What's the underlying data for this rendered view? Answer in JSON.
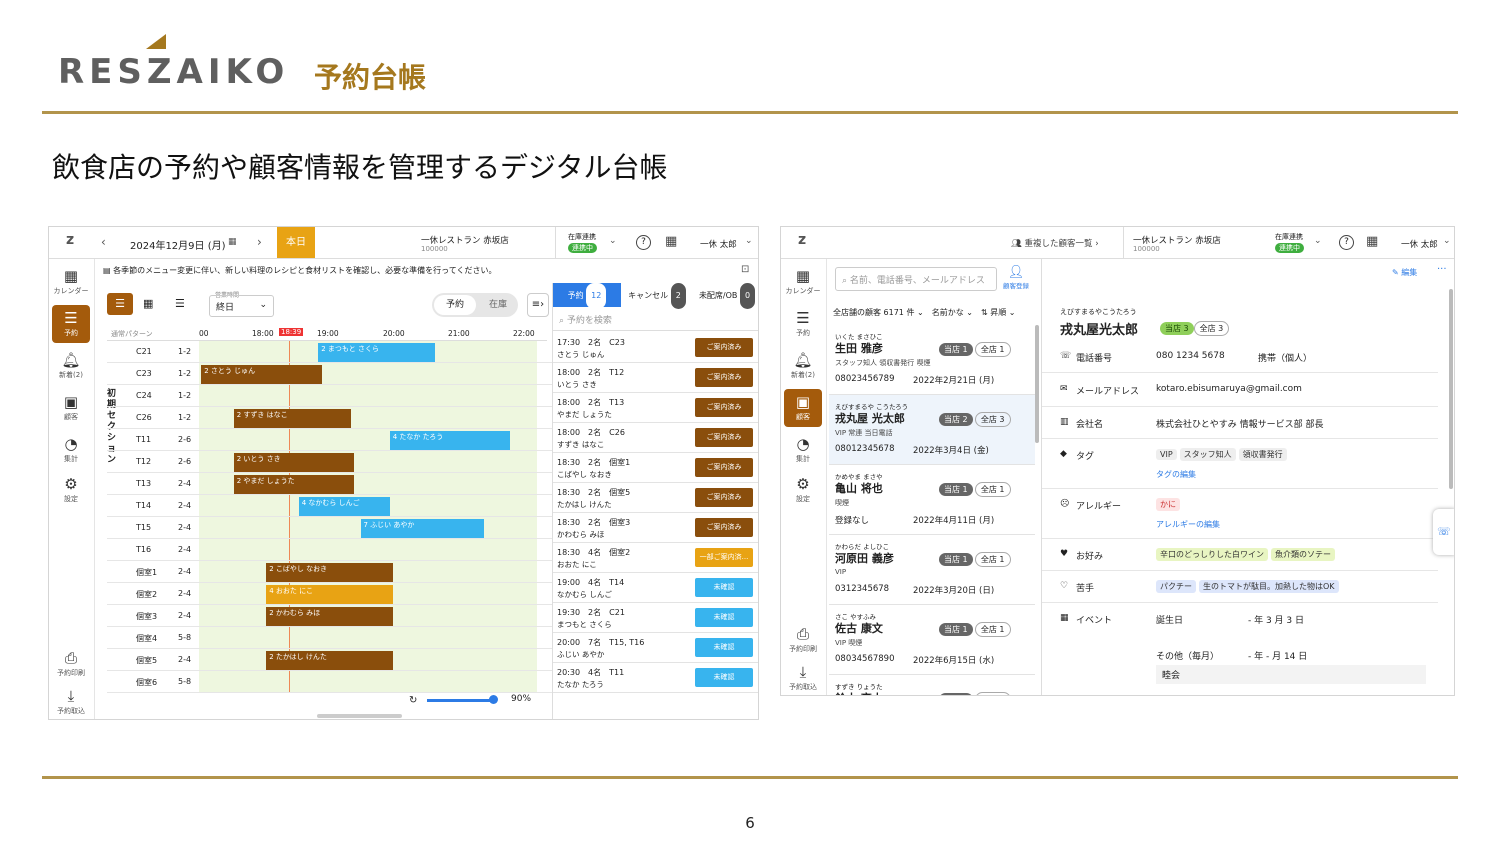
{
  "header": {
    "logo": "RESZAIKO",
    "title": "予約台帳"
  },
  "subtitle": "飲食店の予約や顧客情報を管理するデジタル台帳",
  "page_number": "6",
  "s1": {
    "date": "2024年12月9日 (月)",
    "today": "本日",
    "shop": "一休レストラン 赤坂店",
    "shop_id": "100000",
    "stock_link": "在庫連携",
    "stock_status": "連携中",
    "user": "一休 太郎",
    "notice": "各季節のメニュー変更に伴い、新しい料理のレシピと食材リストを確認し、必要な準備を行ってください。",
    "hours_label": "営業時間",
    "hours_value": "終日",
    "toggle": [
      "予約",
      "在庫"
    ],
    "pattern_label": "通常パターン",
    "times": [
      "00",
      "18:00",
      "19:00",
      "20:00",
      "21:00",
      "22:00"
    ],
    "now_time": "18:39",
    "section_label": "初期セクション",
    "tables": [
      [
        "C21",
        "1-2"
      ],
      [
        "C23",
        "1-2"
      ],
      [
        "C24",
        "1-2"
      ],
      [
        "C26",
        "1-2"
      ],
      [
        "T11",
        "2-6"
      ],
      [
        "T12",
        "2-6"
      ],
      [
        "T13",
        "2-4"
      ],
      [
        "T14",
        "2-4"
      ],
      [
        "T15",
        "2-4"
      ],
      [
        "T16",
        "2-4"
      ],
      [
        "個室1",
        "2-4"
      ],
      [
        "個室2",
        "2-4"
      ],
      [
        "個室3",
        "2-4"
      ],
      [
        "個室4",
        "5-8"
      ],
      [
        "個室5",
        "2-4"
      ],
      [
        "個室6",
        "5-8"
      ]
    ],
    "bars": [
      "2 まつもと さくら",
      "2 さとう じゅん",
      "2 すずき はなこ",
      "4 たなか たろう",
      "2 いとう さき",
      "2 やまだ しょうた",
      "4 なかむら しんご",
      "7 ふじい あやか",
      "2 こばやし なおき",
      "4 おおた にこ",
      "2 かわむら みほ",
      "2 たかはし けんた"
    ],
    "zoom": "90%",
    "tabs": [
      {
        "label": "予約",
        "count": "12"
      },
      {
        "label": "キャンセル",
        "count": "2"
      },
      {
        "label": "未配席/OB",
        "count": "0"
      }
    ],
    "search_placeholder": "予約を検索",
    "reservations": [
      {
        "l1": "17:30　2名　C23",
        "l2": "さとう じゅん",
        "status": "ご案内済み"
      },
      {
        "l1": "18:00　2名　T12",
        "l2": "いとう さき",
        "status": "ご案内済み"
      },
      {
        "l1": "18:00　2名　T13",
        "l2": "やまだ しょうた",
        "status": "ご案内済み"
      },
      {
        "l1": "18:00　2名　C26",
        "l2": "すずき はなこ",
        "status": "ご案内済み"
      },
      {
        "l1": "18:30　2名　個室1",
        "l2": "こばやし なおき",
        "status": "ご案内済み"
      },
      {
        "l1": "18:30　2名　個室5",
        "l2": "たかはし けんた",
        "status": "ご案内済み"
      },
      {
        "l1": "18:30　2名　個室3",
        "l2": "かわむら みほ",
        "status": "ご案内済み"
      },
      {
        "l1": "18:30　4名　個室2",
        "l2": "おおた にこ",
        "status": "一部ご案内済..."
      },
      {
        "l1": "19:00　4名　T14",
        "l2": "なかむら しんご",
        "status": "未確認"
      },
      {
        "l1": "19:30　2名　C21",
        "l2": "まつもと さくら",
        "status": "未確認"
      },
      {
        "l1": "20:00　7名　T15, T16",
        "l2": "ふじい あやか",
        "status": "未確認"
      },
      {
        "l1": "20:30　4名　T11",
        "l2": "たなか たろう",
        "status": "未確認"
      }
    ],
    "nav": [
      "カレンダー",
      "予約",
      "新着(2)",
      "顧客",
      "集計",
      "設定",
      "予約印刷",
      "予約取込"
    ],
    "nav_day": "9"
  },
  "s2": {
    "dup": "重複した顧客一覧",
    "shop": "一休レストラン 赤坂店",
    "shop_id": "100000",
    "stock_link": "在庫連携",
    "stock_status": "連携中",
    "user": "一休 太郎",
    "search_placeholder": "名前、電話番号、メールアドレス",
    "register": "顧客登録",
    "edit": "編集",
    "filter": "全店舗の顧客 6171 件",
    "sort1": "名前かな",
    "sort2": "昇順",
    "customers": [
      {
        "kana": "いくた まさひこ",
        "name": "生田 雅彦",
        "c1": "当店 1",
        "c2": "全店 1",
        "tags": "スタッフ知人 領収書発行 喫煙",
        "tel": "08023456789",
        "date": "2022年2月21日 (月)"
      },
      {
        "kana": "えびすまるや こうたろう",
        "name": "戎丸屋 光太郎",
        "c1": "当店 2",
        "c2": "全店 3",
        "tags": "VIP 常連 当日電話",
        "tel": "08012345678",
        "date": "2022年3月4日 (金)"
      },
      {
        "kana": "かめやま まさや",
        "name": "亀山 将也",
        "c1": "当店 1",
        "c2": "全店 1",
        "tags": "喫煙",
        "tel": "登録なし",
        "date": "2022年4月11日 (月)"
      },
      {
        "kana": "かわらだ よしひこ",
        "name": "河原田 義彦",
        "c1": "当店 1",
        "c2": "全店 1",
        "tags": "VIP",
        "tel": "0312345678",
        "date": "2022年3月20日 (日)"
      },
      {
        "kana": "さこ やすふみ",
        "name": "佐古 康文",
        "c1": "当店 1",
        "c2": "全店 1",
        "tags": "VIP 喫煙",
        "tel": "08034567890",
        "date": "2022年6月15日 (水)"
      },
      {
        "kana": "すずき りょうた",
        "name": "鈴木 亮太",
        "c1": "当店 1",
        "c2": "全店 1",
        "tags": "",
        "tel": "",
        "date": ""
      }
    ],
    "detail": {
      "kana": "えびすまるやこうたろう",
      "name": "戎丸屋光太郎",
      "c1": "当店 3",
      "c2": "全店 3",
      "phone_label": "電話番号",
      "phone": "080 1234 5678",
      "phone_type": "携帯（個人）",
      "email_label": "メールアドレス",
      "email": "kotaro.ebisumaruya@gmail.com",
      "company_label": "会社名",
      "company": "株式会社ひとやすみ 情報サービス部 部長",
      "tag_label": "タグ",
      "tags": [
        "VIP",
        "スタッフ知人",
        "領収書発行"
      ],
      "tag_edit": "タグの編集",
      "allergy_label": "アレルギー",
      "allergy": "かに",
      "allergy_edit": "アレルギーの編集",
      "like_label": "お好み",
      "likes": [
        "辛口のどっしりした白ワイン",
        "魚介類のソテー"
      ],
      "dislike_label": "苦手",
      "dislikes": [
        "パクチー",
        "生のトマトが駄目。加熱した物はOK"
      ],
      "event_label": "イベント",
      "ev1": "誕生日",
      "ev1_date": "- 年 3 月 3 日",
      "ev2": "その他（毎月）",
      "ev2_date": "- 年 - 月 14 日",
      "ev2_note": "睦会"
    },
    "nav": [
      "カレンダー",
      "予約",
      "新着(2)",
      "顧客",
      "集計",
      "設定",
      "予約印刷",
      "予約取込"
    ],
    "nav_day": "9"
  },
  "colors": {
    "gold": "#a5781e",
    "brown": "#8a4e0c",
    "orange": "#e8a314",
    "blue": "#38b4ee"
  }
}
